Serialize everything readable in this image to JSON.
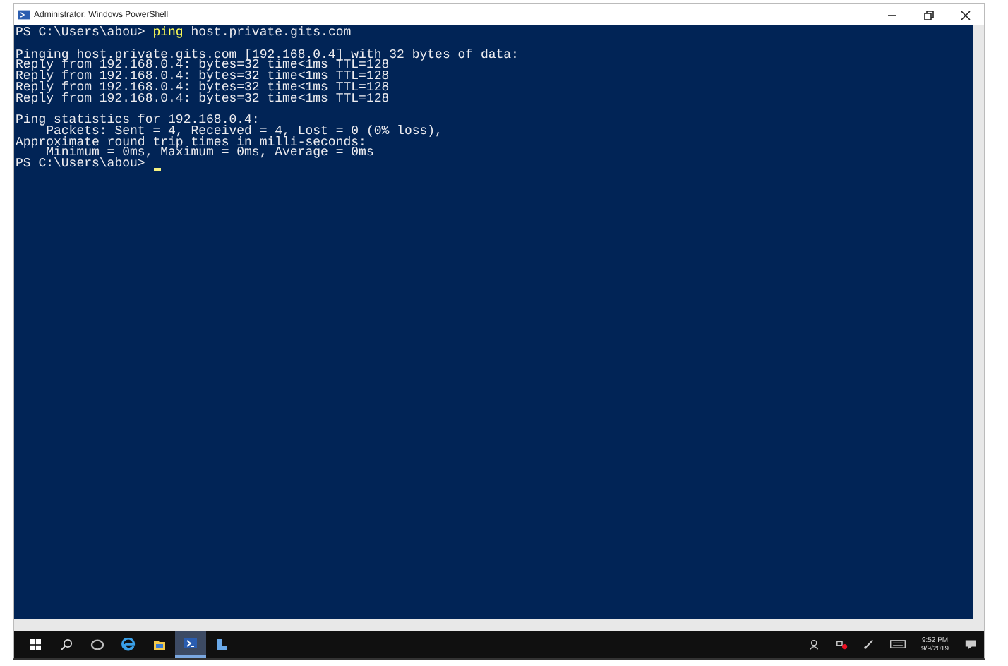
{
  "window": {
    "title": "Administrator: Windows PowerShell"
  },
  "console": {
    "lines": [
      {
        "kind": "command",
        "prompt": "PS C:\\Users\\abou>",
        "command": "ping",
        "args": "host.private.gits.com"
      },
      {
        "kind": "blank"
      },
      {
        "kind": "output",
        "text": "Pinging host.private.gits.com [192.168.0.4] with 32 bytes of data:"
      },
      {
        "kind": "output",
        "text": "Reply from 192.168.0.4: bytes=32 time<1ms TTL=128"
      },
      {
        "kind": "output",
        "text": "Reply from 192.168.0.4: bytes=32 time<1ms TTL=128"
      },
      {
        "kind": "output",
        "text": "Reply from 192.168.0.4: bytes=32 time<1ms TTL=128"
      },
      {
        "kind": "output",
        "text": "Reply from 192.168.0.4: bytes=32 time<1ms TTL=128"
      },
      {
        "kind": "blank"
      },
      {
        "kind": "output",
        "text": "Ping statistics for 192.168.0.4:"
      },
      {
        "kind": "output",
        "text": "    Packets: Sent = 4, Received = 4, Lost = 0 (0% loss),"
      },
      {
        "kind": "output",
        "text": "Approximate round trip times in milli-seconds:"
      },
      {
        "kind": "output",
        "text": "    Minimum = 0ms, Maximum = 0ms, Average = 0ms"
      },
      {
        "kind": "prompt",
        "prompt": "PS C:\\Users\\abou>",
        "cursor": true
      }
    ]
  },
  "taskbar": {
    "apps": [
      {
        "kind": "start",
        "selected": false
      },
      {
        "kind": "search",
        "selected": false
      },
      {
        "kind": "taskview",
        "selected": false
      },
      {
        "kind": "browser",
        "selected": false
      },
      {
        "kind": "folder",
        "selected": false
      },
      {
        "kind": "powershell",
        "selected": true
      },
      {
        "kind": "server",
        "selected": false
      }
    ],
    "clock": {
      "time": "9:52 PM",
      "date": "9/9/2019"
    }
  }
}
